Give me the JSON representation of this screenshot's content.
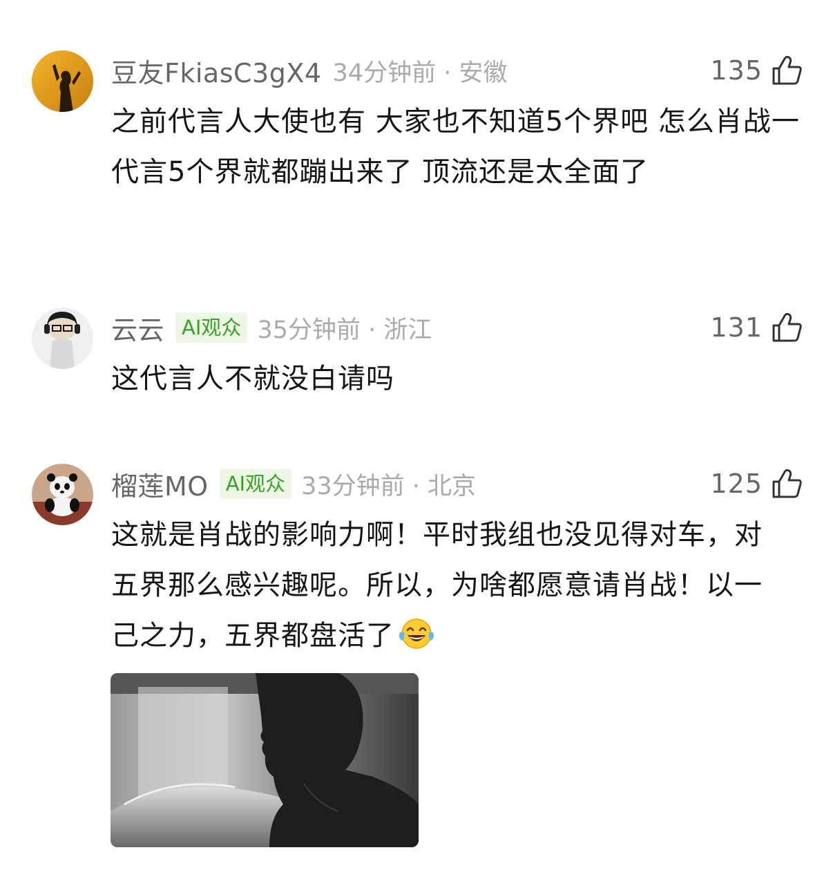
{
  "comments": [
    {
      "username": "豆友FkiasC3gX4",
      "badge": "",
      "meta": "34分钟前 · 安徽",
      "likes": "135",
      "text": "之前代言人大使也有 大家也不知道5个界吧 怎么肖战一代言5个界就都蹦出来了 顶流还是太全面了"
    },
    {
      "username": "云云",
      "badge": "AI观众",
      "meta": "35分钟前 · 浙江",
      "likes": "131",
      "text": "这代言人不就没白请吗"
    },
    {
      "username": "榴莲MO",
      "badge": "AI观众",
      "meta": "33分钟前 · 北京",
      "likes": "125",
      "text": "这就是肖战的影响力啊！平时我组也没见得对车，对五界那么感兴趣呢。所以，为啥都愿意请肖战！以一己之力，五界都盘活了",
      "emoji": "laughing-tears-emoji",
      "image": "photo-man-profile-car"
    }
  ],
  "icons": {
    "like": "thumbs-up-icon"
  },
  "colors": {
    "username": "#666666",
    "meta": "#aaaaaa",
    "badge_text": "#36a326",
    "badge_bg": "#eef6e6"
  }
}
